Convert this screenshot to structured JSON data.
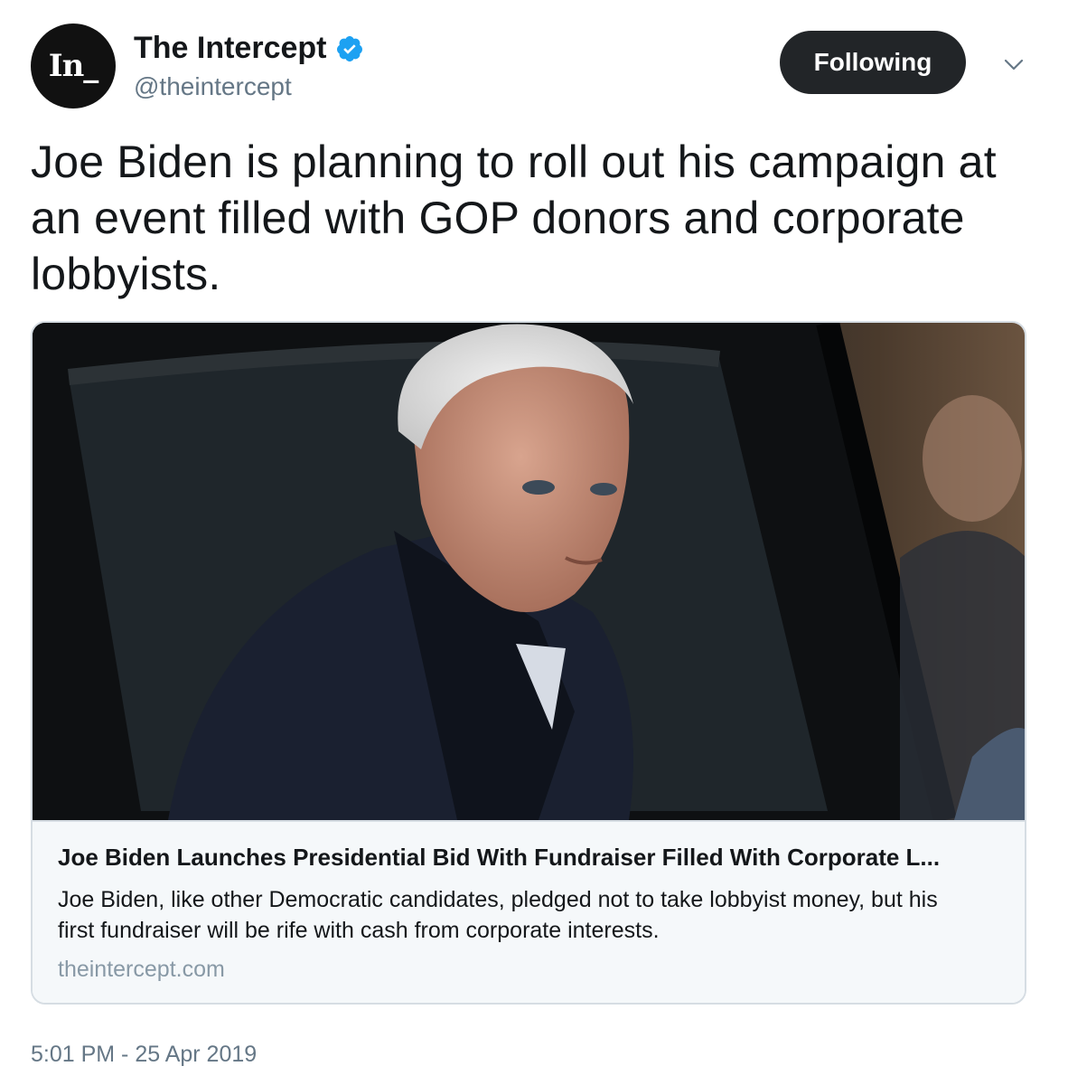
{
  "account": {
    "avatar_text": "In_",
    "display_name": "The Intercept",
    "handle": "@theintercept",
    "follow_label": "Following"
  },
  "tweet": {
    "text": "Joe Biden is planning to roll out his campaign at an event filled with GOP donors and corporate lobbyists.",
    "timestamp": "5:01 PM - 25 Apr 2019"
  },
  "card": {
    "title": "Joe Biden Launches Presidential Bid With Fundraiser Filled With Corporate L...",
    "description": "Joe Biden, like other Democratic candidates, pledged not to take lobbyist money, but his first fundraiser will be rife with cash from corporate interests.",
    "domain": "theintercept.com"
  },
  "icons": {
    "verified": "verified-badge-icon",
    "caret": "chevron-down-icon"
  },
  "colors": {
    "verified": "#1da1f2",
    "follow_button": "#222528",
    "secondary_text": "#657786",
    "card_bg": "#f5f8fa"
  }
}
